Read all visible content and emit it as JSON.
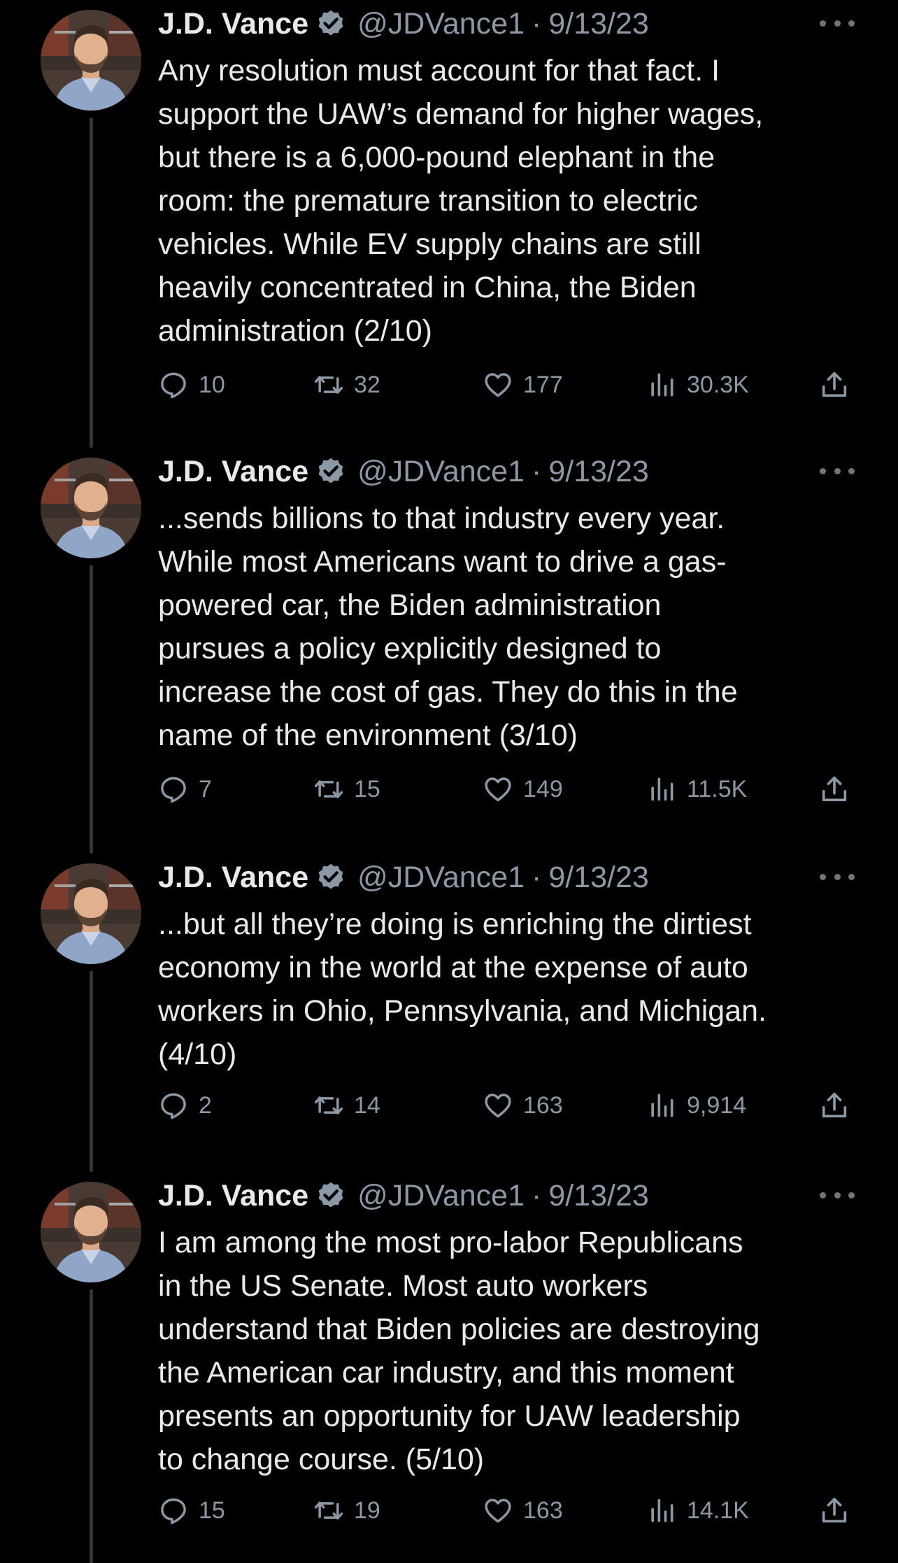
{
  "colors": {
    "background": "#000000",
    "text": "#e7e9ea",
    "secondary": "#8b98a5",
    "verified": "#8b98a5",
    "thread_line": "#333639"
  },
  "tweets": [
    {
      "name": "J.D. Vance",
      "handle": "@JDVance1",
      "separator": "·",
      "date": "9/13/23",
      "text": "Any resolution must account for that fact. I\nsupport the UAW’s demand for higher wages,\nbut there is a 6,000-pound elephant in the\nroom: the premature transition to electric\nvehicles. While EV supply chains are still\nheavily concentrated in China, the Biden\nadministration (2/10)",
      "replies": "10",
      "retweets": "32",
      "likes": "177",
      "views": "30.3K"
    },
    {
      "name": "J.D. Vance",
      "handle": "@JDVance1",
      "separator": "·",
      "date": "9/13/23",
      "text": "...sends billions to that industry every year.\nWhile most Americans want to drive a gas-\npowered car, the Biden administration\npursues a policy explicitly designed to\nincrease the cost of gas. They do this in the\nname of the environment (3/10)",
      "replies": "7",
      "retweets": "15",
      "likes": "149",
      "views": "11.5K"
    },
    {
      "name": "J.D. Vance",
      "handle": "@JDVance1",
      "separator": "·",
      "date": "9/13/23",
      "text": "...but all they’re doing is enriching the dirtiest\neconomy in the world at the expense of auto\nworkers in Ohio, Pennsylvania, and Michigan.\n(4/10)",
      "replies": "2",
      "retweets": "14",
      "likes": "163",
      "views": "9,914"
    },
    {
      "name": "J.D. Vance",
      "handle": "@JDVance1",
      "separator": "·",
      "date": "9/13/23",
      "text": "I am among the most pro-labor Republicans\nin the US Senate. Most auto workers\nunderstand that Biden policies are destroying\nthe American car industry, and this moment\npresents an opportunity for UAW leadership\nto change course. (5/10)",
      "replies": "15",
      "retweets": "19",
      "likes": "163",
      "views": "14.1K"
    }
  ]
}
